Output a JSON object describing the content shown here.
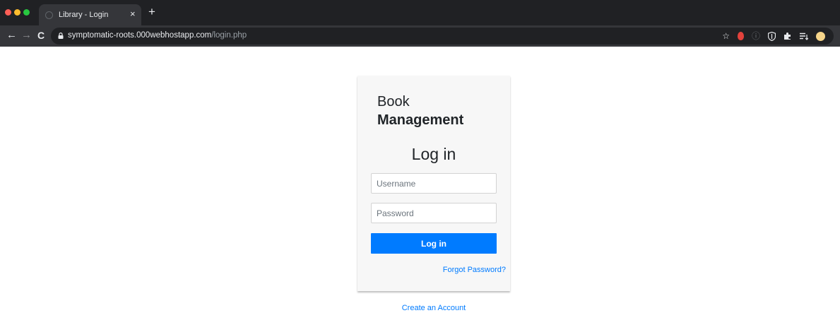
{
  "browser": {
    "tab_title": "Library - Login",
    "tab_close": "×",
    "new_tab": "+",
    "url_host": "symptomatic-roots.000webhostapp.com",
    "url_path": "/login.php",
    "nav": {
      "back": "←",
      "forward": "→",
      "reload": "C"
    },
    "icons": [
      "star-icon",
      "extension-red-icon",
      "info-icon",
      "shield-icon",
      "puzzle-icon",
      "reading-list-icon",
      "profile-avatar"
    ]
  },
  "login": {
    "brand_line1": "Book",
    "brand_line2": "Management",
    "title": "Log in",
    "username_placeholder": "Username",
    "password_placeholder": "Password",
    "submit_label": "Log in",
    "forgot_label": "Forgot Password?",
    "create_account_label": "Create an Account"
  },
  "colors": {
    "primary": "#007bff",
    "card_bg": "#f7f7f7",
    "chrome_dark": "#202124",
    "chrome_toolbar": "#35363a"
  }
}
